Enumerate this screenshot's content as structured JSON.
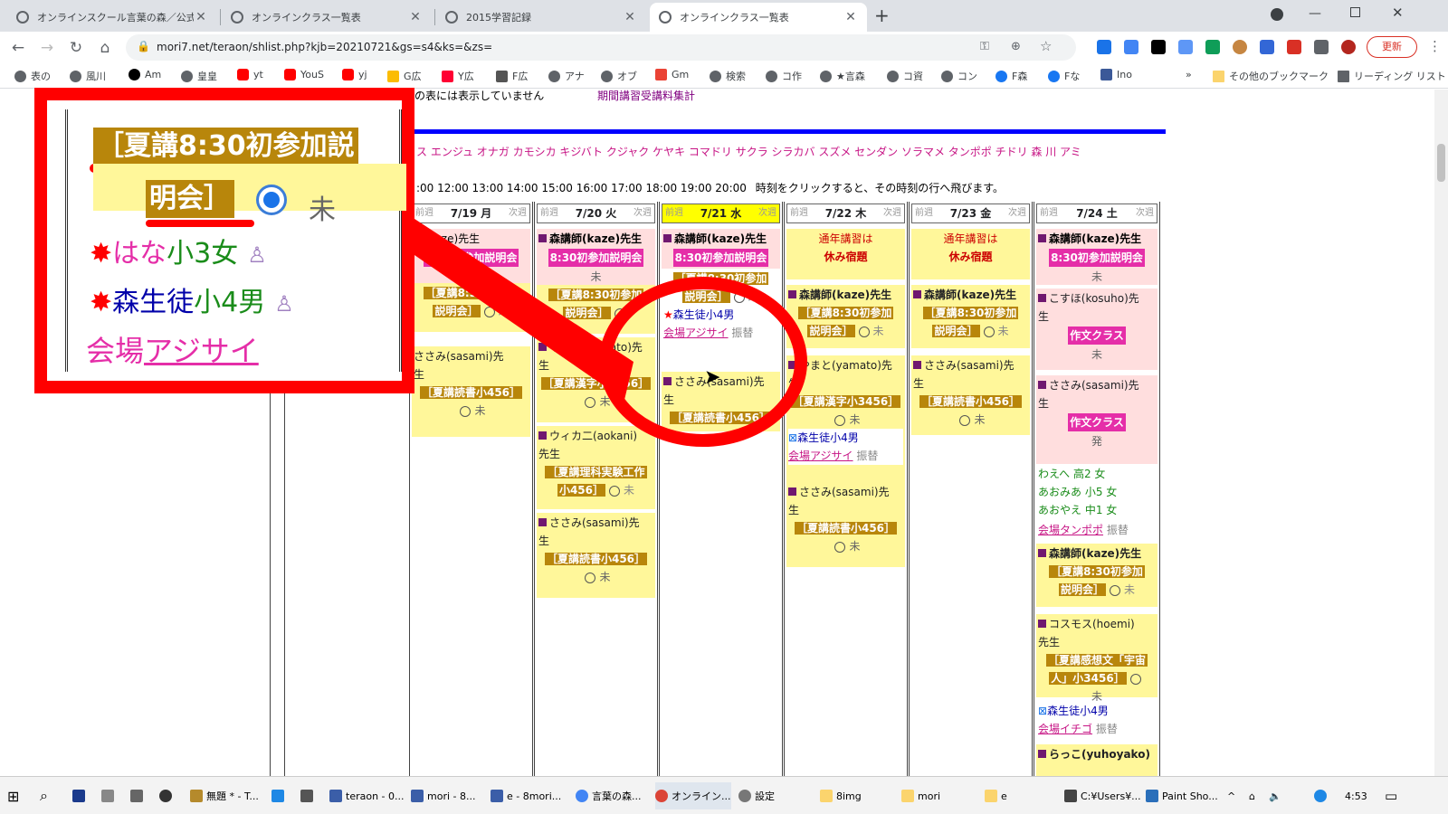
{
  "browser": {
    "tabs": [
      {
        "title": "オンラインスクール言葉の森／公式ホ",
        "active": false
      },
      {
        "title": "オンラインクラス一覧表",
        "active": false
      },
      {
        "title": "2015学習記録",
        "active": false
      },
      {
        "title": "オンラインクラス一覧表",
        "active": true
      }
    ],
    "new_tab_label": "+",
    "url": "mori7.net/teraon/shlist.php?kjb=20210721&gs=s4&ks=&zs=",
    "update_label": "更新",
    "bookmarks": [
      "表の",
      "風川",
      "Am",
      "皇皇",
      "yt",
      "YouS",
      "yj",
      "G広",
      "Y広",
      "F広",
      "アナ",
      "オブ",
      "Gm",
      "検索",
      "コ作",
      "★言森",
      "コ資",
      "コン",
      "F森",
      "Fな",
      "Ino"
    ],
    "bookmarks_more": "»",
    "other_bookmarks": "その他のブックマーク",
    "reading_list": "リーディング リスト"
  },
  "page": {
    "top_note": "の表には表示していません",
    "top_link": "期間講習受講料集計",
    "names_row": "ス エンジュ オナガ カモシカ キジバト クジャク ケヤキ コマドリ サクラ シラカバ スズメ センダン ソラマメ タンポポ チドリ 森 川 アミ",
    "times_row": ":00 12:00 13:00 14:00 15:00 16:00 17:00 18:00 19:00 20:00",
    "times_note": "時刻をクリックすると、その時刻の行へ飛びます。",
    "prev_week": "前週",
    "next_week": "次週",
    "days": [
      {
        "label": "7/19 月",
        "today": false
      },
      {
        "label": "7/20 火",
        "today": false
      },
      {
        "label": "7/21 水",
        "today": true
      },
      {
        "label": "7/22 木",
        "today": false
      },
      {
        "label": "7/23 金",
        "today": false
      },
      {
        "label": "7/24 土",
        "today": false
      }
    ],
    "col1": {
      "c1_teacher": "師(kaze)先生",
      "c1_mag": "8:30初参加説明会",
      "c1_status": "未",
      "c1_gold": "［夏講8:30初参加",
      "c1_gold2": "説明会］",
      "c1_status2": "未",
      "c2_teacher": "ささみ(sasami)先",
      "c2_sei": "生",
      "c2_gold": "［夏講読書小456］",
      "c2_status": "未"
    },
    "col2": {
      "c1_teacher": "森講師(kaze)先生",
      "c1_mag": "8:30初参加説明会",
      "c1_status": "未",
      "c1_gold": "［夏講8:30初参加",
      "c1_gold2": "説明会］",
      "c2_teacher": "やまと(yamato)先",
      "c2_sei": "生",
      "c2_gold": "［夏講漢字小3456］",
      "c2_status": "未",
      "c3_teacher": "ウィカ二(aokani)",
      "c3_sei": "先生",
      "c3_gold": "［夏講理科実験工作",
      "c3_gold2": "小456］",
      "c3_status": "未",
      "c4_teacher": "ささみ(sasami)先",
      "c4_sei": "生",
      "c4_gold": "［夏講読書小456］",
      "c4_status": "未"
    },
    "col3": {
      "c1_teacher": "森講師(kaze)先生",
      "c1_mag": "8:30初参加説明会",
      "c1_gold": "［夏講8:30初参加",
      "c1_gold2": "説明会］",
      "c1_status": "未",
      "c1_student": "森生徒小4男",
      "c1_venue_prefix": "会場",
      "c1_venue": "アジサイ",
      "c1_swap": "振替",
      "c2_teacher": "ささみ(sasami)先",
      "c2_sei": "生",
      "c2_gold": "［夏講読書小456］"
    },
    "col4": {
      "c1_line1": "通年講習は",
      "c1_line2": "休み宿題",
      "c2_teacher": "森講師(kaze)先生",
      "c2_gold": "［夏講8:30初参加",
      "c2_gold2": "説明会］",
      "c2_status": "未",
      "c3_teacher": "やまと(yamato)先",
      "c3_sei": "生",
      "c3_gold": "［夏講漢字小3456］",
      "c3_status": "未",
      "c3_student": "森生徒小4男",
      "c3_venue_prefix": "会場",
      "c3_venue": "アジサイ",
      "c3_swap": "振替",
      "c4_teacher": "ささみ(sasami)先",
      "c4_sei": "生",
      "c4_gold": "［夏講読書小456］",
      "c4_status": "未"
    },
    "col5": {
      "c1_line1": "通年講習は",
      "c1_line2": "休み宿題",
      "c2_teacher": "森講師(kaze)先生",
      "c2_gold": "［夏講8:30初参加",
      "c2_gold2": "説明会］",
      "c2_status": "未",
      "c3_teacher": "ささみ(sasami)先",
      "c3_sei": "生",
      "c3_gold": "［夏講読書小456］",
      "c3_status": "未"
    },
    "col6": {
      "c1_teacher": "森講師(kaze)先生",
      "c1_mag": "8:30初参加説明会",
      "c1_status": "未",
      "c2_teacher": "こすほ(kosuho)先",
      "c2_sei": "生",
      "c2_mag": "作文クラス",
      "c2_status": "未",
      "c3_teacher": "ささみ(sasami)先",
      "c3_sei": "生",
      "c3_mag": "作文クラス",
      "c3_status": "発",
      "c3_s1": "わえへ 高2 女",
      "c3_s2": "あおみあ 小5 女",
      "c3_s3": "あおやえ 中1 女",
      "c3_venue_prefix": "会場",
      "c3_venue": "タンポポ",
      "c3_swap": "振替",
      "c4_teacher": "森講師(kaze)先生",
      "c4_gold": "［夏講8:30初参加",
      "c4_gold2": "説明会］",
      "c4_status": "未",
      "c5_teacher": "コスモス(hoemi)",
      "c5_sei": "先生",
      "c5_gold": "［夏講感想文「宇宙",
      "c5_gold2": "人」小3456］",
      "c5_status": "未",
      "c5_student": "森生徒小4男",
      "c5_venue_prefix": "会場",
      "c5_venue": "イチゴ",
      "c5_swap": "振替",
      "c6_teacher": "らっこ(yuhoyako)"
    }
  },
  "zoom": {
    "gold_line1": "［夏講8:30初参加説",
    "gold_line2": "明会］",
    "status": "未",
    "student1_name": "はな",
    "student1_grade": "小3女",
    "student2_name": "森生徒",
    "student2_grade": "小4男",
    "venue_prefix": "会場",
    "venue": "アジサイ"
  },
  "taskbar": {
    "items": [
      "無題 * - T...",
      "teraon - 0...",
      "mori - 8...",
      "e - 8mori...",
      "言葉の森...",
      "オンライン...",
      "設定",
      "8img",
      "mori",
      "e",
      "C:¥Users¥...",
      "Paint Sho..."
    ],
    "time": "4:53"
  },
  "colors": {
    "accent_red": "#ff0000",
    "gold": "#b8860b",
    "magenta": "#e52ea8",
    "pink_bg": "#ffdede",
    "yellow_bg": "#fff79a",
    "today_yellow": "#ffff00"
  }
}
